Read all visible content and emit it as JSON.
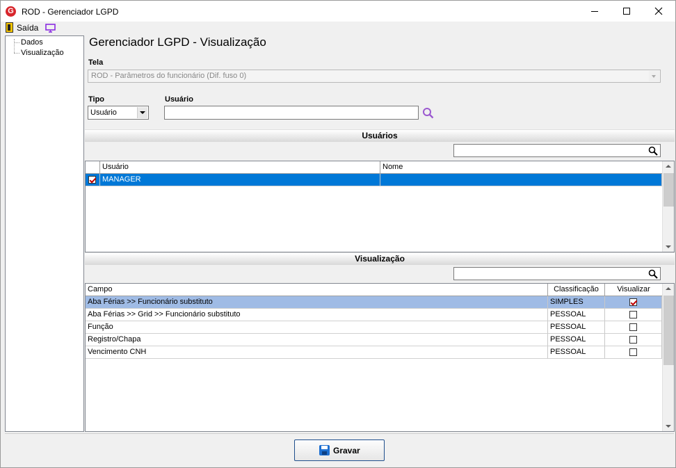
{
  "window": {
    "title": "ROD - Gerenciador LGPD"
  },
  "menubar": {
    "exit_label": "Saída"
  },
  "tree": {
    "items": [
      "Dados",
      "Visualização"
    ]
  },
  "main": {
    "title": "Gerenciador LGPD - Visualização",
    "tela_label": "Tela",
    "tela_value": "ROD - Parâmetros do funcionário (Dif. fuso 0)",
    "tipo_label": "Tipo",
    "tipo_value": "Usuário",
    "usuario_label": "Usuário",
    "usuario_value": ""
  },
  "users_section": {
    "title": "Usuários",
    "columns": [
      "Usuário",
      "Nome"
    ],
    "rows": [
      {
        "checked": true,
        "usuario": "MANAGER",
        "nome": ""
      }
    ]
  },
  "view_section": {
    "title": "Visualização",
    "columns": [
      "Campo",
      "Classificação",
      "Visualizar"
    ],
    "rows": [
      {
        "campo": "Aba Férias >> Funcionário substituto",
        "classificacao": "SIMPLES",
        "visualizar": true
      },
      {
        "campo": "Aba Férias >> Grid >> Funcionário substituto",
        "classificacao": "PESSOAL",
        "visualizar": false
      },
      {
        "campo": "Função",
        "classificacao": "PESSOAL",
        "visualizar": false
      },
      {
        "campo": "Registro/Chapa",
        "classificacao": "PESSOAL",
        "visualizar": false
      },
      {
        "campo": "Vencimento CNH",
        "classificacao": "PESSOAL",
        "visualizar": false
      }
    ]
  },
  "footer": {
    "save_label": "Gravar"
  },
  "colors": {
    "selection": "#0078d7",
    "selection_light": "#9fbbe5",
    "check": "#c00000",
    "app_icon": "#d8262c"
  }
}
